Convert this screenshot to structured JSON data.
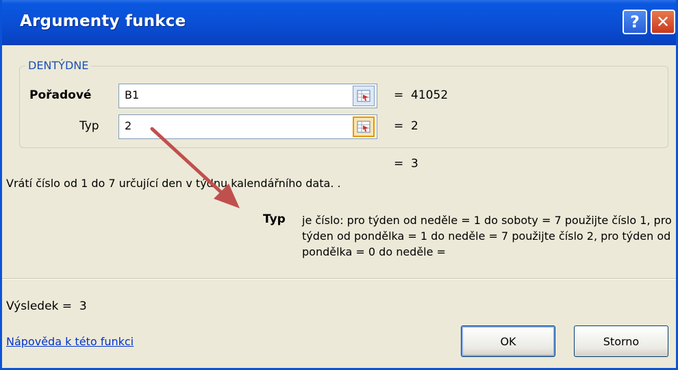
{
  "window": {
    "title": "Argumenty funkce",
    "help_glyph": "?",
    "close_glyph": "✕"
  },
  "function": {
    "name": "DENTÝDNE",
    "args": [
      {
        "label": "Pořadové",
        "value": "B1",
        "result": "=  41052"
      },
      {
        "label": "Typ",
        "value": "2",
        "result": "=  2"
      }
    ],
    "total_result": "=  3",
    "description": "Vrátí číslo od 1 do 7 určující den v týdnu kalendářního data. .",
    "detail_name": "Typ",
    "detail_text": "je číslo: pro týden od neděle = 1 do soboty = 7 použijte číslo 1, pro týden od pondělka = 1 do neděle = 7 použijte číslo 2, pro týden od pondělka = 0 do neděle ="
  },
  "footer": {
    "result_label": "Výsledek =  3",
    "help_link": "Nápověda k této funkci",
    "ok_label": "OK",
    "cancel_label": "Storno"
  },
  "colors": {
    "titlebar": "#0a4fd6",
    "legend": "#1a50b8",
    "link": "#0033cc",
    "annotation_arrow": "#c0504d"
  },
  "icons": {
    "ref_button": "range-select-icon",
    "overlay": "annotation-arrow"
  }
}
